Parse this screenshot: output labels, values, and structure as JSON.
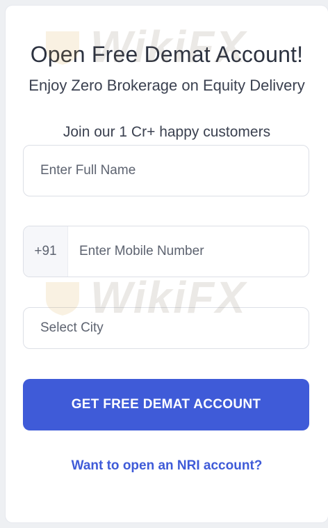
{
  "form": {
    "title": "Open Free Demat Account!",
    "subtitle": "Enjoy Zero Brokerage on Equity Delivery",
    "tagline": "Join our 1 Cr+ happy customers",
    "name_placeholder": "Enter Full Name",
    "phone_prefix": "+91",
    "mobile_placeholder": "Enter Mobile Number",
    "city_placeholder": "Select City",
    "submit_label": "GET FREE DEMAT ACCOUNT",
    "nri_link": "Want to open an NRI account?"
  },
  "watermark": {
    "text": "WikiFX"
  },
  "colors": {
    "accent": "#3f5bd8",
    "title": "#2c3240",
    "border": "#dcdfe6"
  }
}
